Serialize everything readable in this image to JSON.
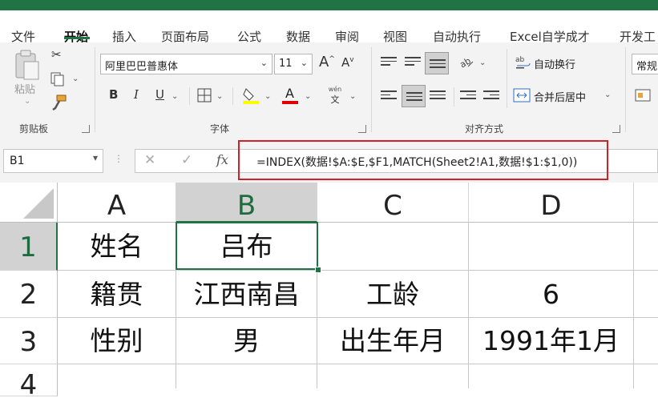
{
  "menu": {
    "tabs": [
      "文件",
      "开始",
      "插入",
      "页面布局",
      "公式",
      "数据",
      "审阅",
      "视图",
      "自动执行",
      "Excel自学成才",
      "开发工"
    ],
    "active": "开始"
  },
  "ribbon": {
    "clipboard": {
      "paste_label": "粘贴",
      "group_label": "剪贴板"
    },
    "font": {
      "font_name": "阿里巴巴普惠体",
      "font_size": "11",
      "grow": "A",
      "shrink": "A",
      "bold": "B",
      "italic": "I",
      "underline": "U",
      "font_color_glyph": "A",
      "phonetic_top": "wén",
      "phonetic_bottom": "文",
      "group_label": "字体"
    },
    "alignment": {
      "wrap_text": "自动换行",
      "merge_center": "合并后居中",
      "group_label": "对齐方式"
    },
    "number": {
      "format": "常规"
    }
  },
  "formula_bar": {
    "name_box": "B1",
    "fx": "fx",
    "formula": "=INDEX(数据!$A:$E,$F1,MATCH(Sheet2!A1,数据!$1:$1,0))"
  },
  "sheet": {
    "columns": [
      "A",
      "B",
      "C",
      "D"
    ],
    "rows": [
      "1",
      "2",
      "3",
      "4"
    ],
    "cells": [
      [
        "姓名",
        "吕布",
        "",
        ""
      ],
      [
        "籍贯",
        "江西南昌",
        "工龄",
        "6"
      ],
      [
        "性别",
        "男",
        "出生年月",
        "1991年1月"
      ]
    ],
    "selected_cell": "B1"
  },
  "colors": {
    "accent": "#217346",
    "highlight_border": "#d0202a"
  }
}
